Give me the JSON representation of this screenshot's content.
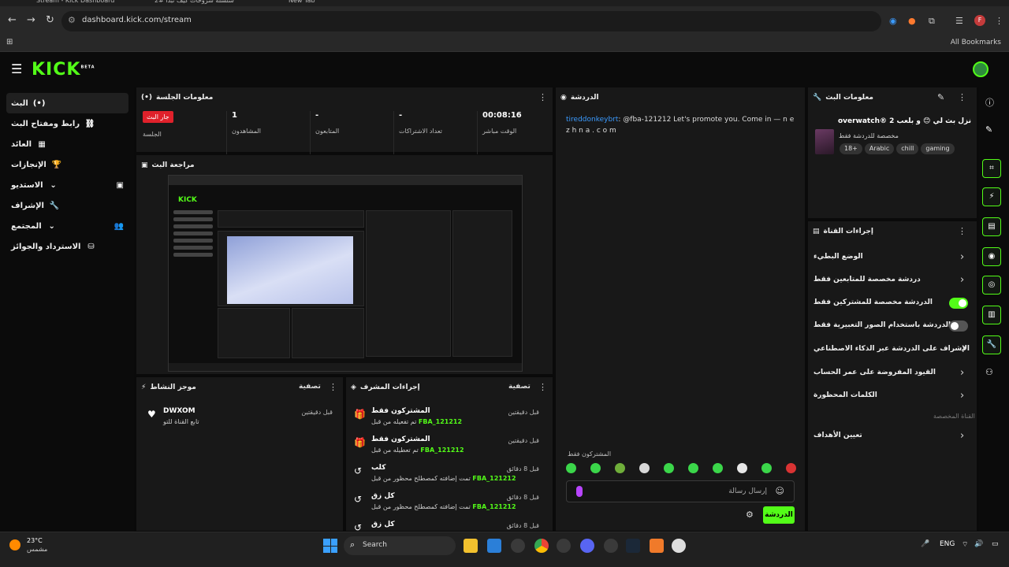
{
  "browser": {
    "tabs": [
      "Stream - Kick Dashboard",
      "سلسلة شروحات كيف تبدا #2",
      "New Tab"
    ],
    "url": "dashboard.kick.com/stream",
    "bookmarks_label": "All Bookmarks",
    "profile_initial": "F"
  },
  "brand": {
    "logo": "KICK",
    "badge": "BETA"
  },
  "sidebar": {
    "items": [
      {
        "label": "البث",
        "icon": "(•)"
      },
      {
        "label": "رابط ومفتاح البث",
        "icon": "⛓"
      },
      {
        "label": "العائد",
        "icon": "▦"
      },
      {
        "label": "الإنجازات",
        "icon": "🏆"
      },
      {
        "label": "الاستديو",
        "icon": "⌄"
      },
      {
        "label": "الإشراف",
        "icon": "🔧"
      },
      {
        "label": "المجتمع",
        "icon": "⌄"
      },
      {
        "label": "الاسترداد والجوائز",
        "icon": "⛁"
      }
    ]
  },
  "session": {
    "title": "معلومات الجلسة",
    "live_badge": "جار البث",
    "stats": [
      {
        "value": "",
        "label": "الجلسة"
      },
      {
        "value": "1",
        "label": "المشاهدون"
      },
      {
        "value": "-",
        "label": "المتابعون"
      },
      {
        "value": "-",
        "label": "تعداد الاشتراكات"
      },
      {
        "value": "00:08:16",
        "label": "الوقت مباشر"
      }
    ]
  },
  "preview": {
    "title": "مراجعة البث"
  },
  "chat": {
    "title": "الدردشة",
    "message_user": "tireddonkeybrt",
    "message_text": ": @fba-121212 Let's promote you. Come in — n e z h n a . c o m",
    "subs_only_label": "المشتركون فقط",
    "input_placeholder": "إرسال رسالة",
    "send_label": "الدردشة"
  },
  "stream_info": {
    "title": "معلومات البث",
    "stream_title": "overwatch® 2 نزل بث لي 😊 و بلعب",
    "category": "مخصصة للدردشة فقط",
    "tags": [
      "18+",
      "Arabic",
      "chill",
      "gaming"
    ]
  },
  "quick_actions": {
    "title": "إجراءات القناة",
    "items": [
      {
        "label": "الوضع البطيء",
        "kind": "chevron"
      },
      {
        "label": "دردشة مخصصة للمتابعين فقط",
        "kind": "chevron"
      },
      {
        "label": "الدردشة مخصصة للمشتركين فقط",
        "kind": "toggle-on"
      },
      {
        "label": "الدردشة باستخدام الصور التعبيرية فقط",
        "kind": "toggle-off"
      },
      {
        "label": "الإشراف على الدردشة عبر الذكاء الاصطناعي",
        "kind": "external"
      },
      {
        "label": "القيود المفروضة على عمر الحساب",
        "kind": "chevron"
      },
      {
        "label": "الكلمات المحظورة",
        "kind": "chevron"
      },
      {
        "label": "تعيين الأهداف",
        "kind": "chevron"
      }
    ],
    "section_label": "القناة المخصصة"
  },
  "activity": {
    "title": "موجز النشاط",
    "filter_label": "تصفية",
    "items": [
      {
        "name": "DWXOM",
        "sub": "تابع القناة للتو",
        "time": "قبل دقيقتين"
      }
    ]
  },
  "mod_actions": {
    "title": "إجراءات المشرف",
    "filter_label": "تصفية",
    "items": [
      {
        "title": "المشتركون فقط",
        "sub": "تم تفعيله من قبل",
        "user": "FBA_121212",
        "time": "قبل دقيقتين",
        "icon": "🎁"
      },
      {
        "title": "المشتركون فقط",
        "sub": "تم تعطيله من قبل",
        "user": "FBA_121212",
        "time": "قبل دقيقتين",
        "icon": "🎁"
      },
      {
        "title": "كلب",
        "sub": "تمت إضافته كمصطلح محظور من قبل",
        "user": "FBA_121212",
        "time": "قبل 8 دقائق",
        "icon": "↺"
      },
      {
        "title": "كل زق",
        "sub": "تمت إضافته كمصطلح محظور من قبل",
        "user": "FBA_121212",
        "time": "قبل 8 دقائق",
        "icon": "↺"
      },
      {
        "title": "كل زق",
        "sub": "",
        "user": "",
        "time": "قبل 8 دقائق",
        "icon": "↺"
      }
    ]
  },
  "taskbar": {
    "temp": "23°C",
    "weather": "مشمس",
    "search": "Search",
    "lang": "ENG"
  },
  "colors": {
    "accent": "#53fc18",
    "live": "#e0212b",
    "link": "#3b9bff"
  }
}
